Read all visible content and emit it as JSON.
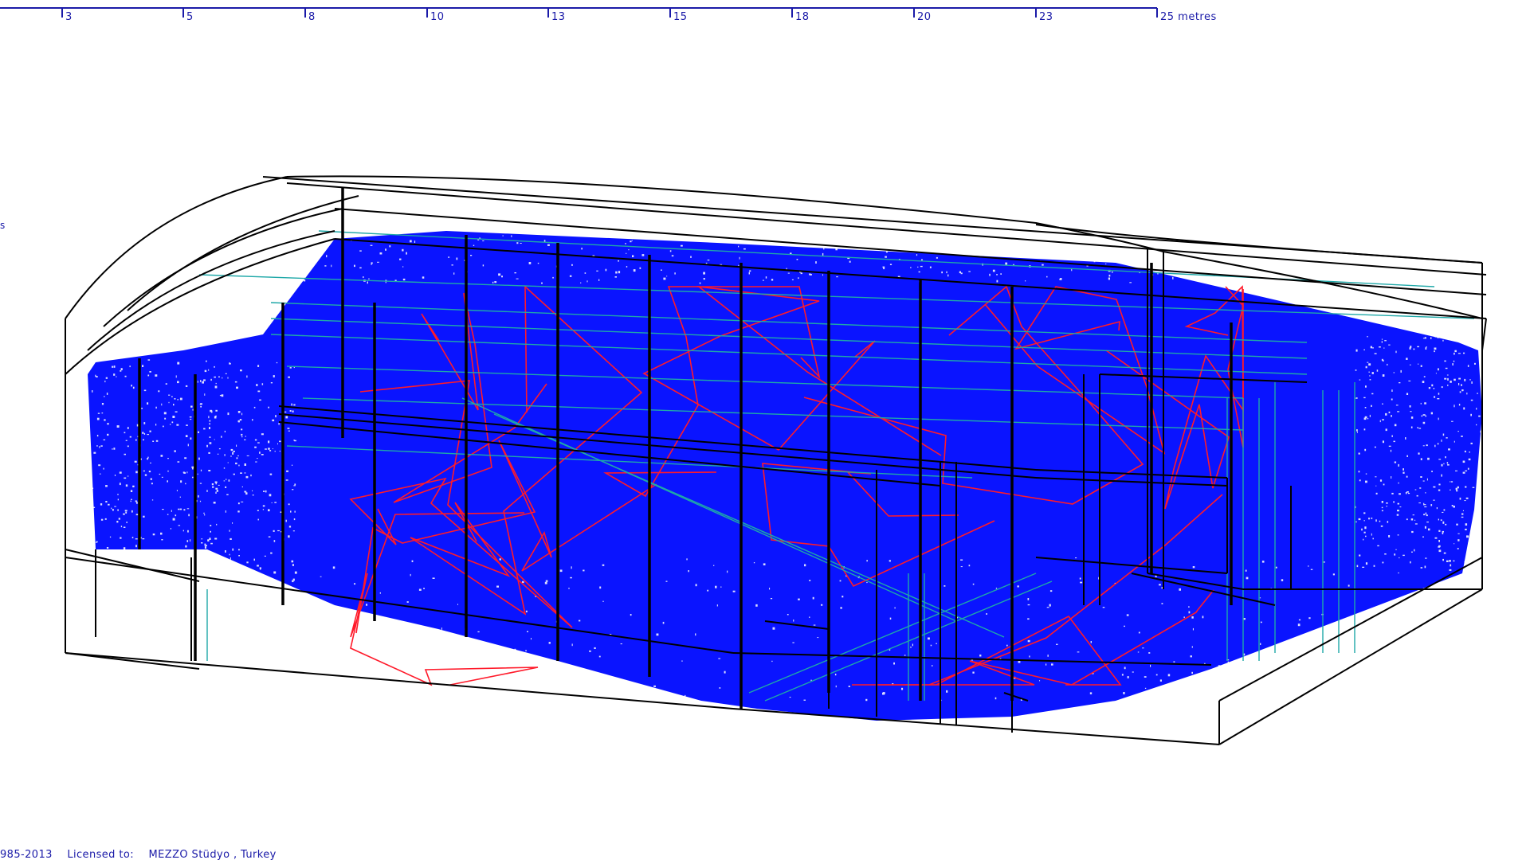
{
  "scale_bar": {
    "ticks": [
      "3",
      "5",
      "8",
      "10",
      "13",
      "15",
      "18",
      "20",
      "23",
      "25 metres"
    ]
  },
  "side_mark": "s",
  "status": {
    "copyright": "985-2013",
    "licensed_label": "Licensed to:",
    "licensee": "MEZZO Stüdyo , Turkey"
  },
  "colors": {
    "ray_fill": "#0a14ff",
    "ray_trace": "#ff1a2a",
    "wireframe": "#000000",
    "surface_edge": "#1fa8a8",
    "scale_text": "#1a1aa8"
  }
}
